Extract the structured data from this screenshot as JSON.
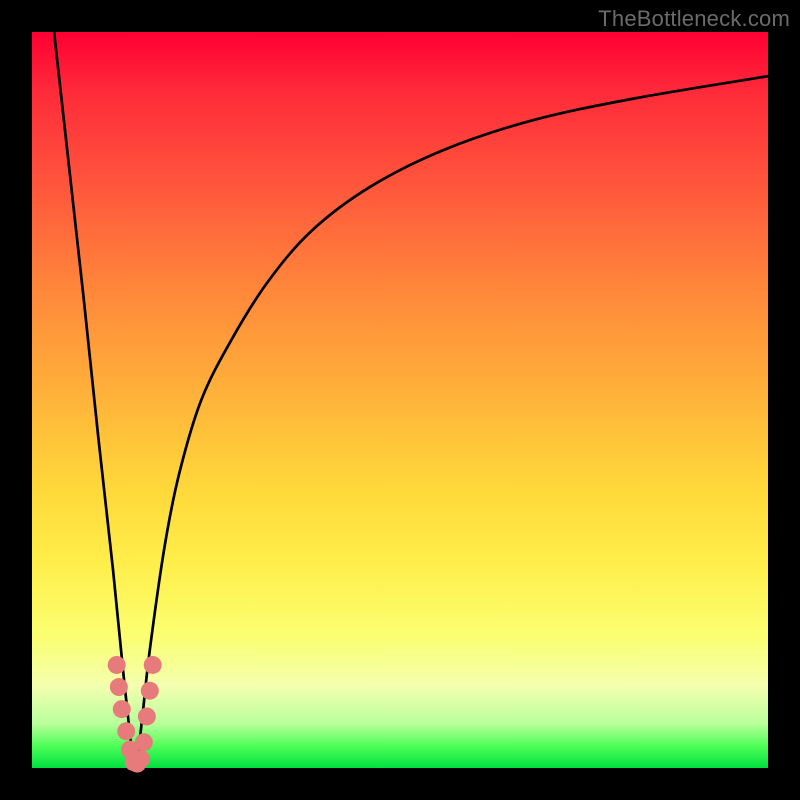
{
  "watermark": "TheBottleneck.com",
  "chart_data": {
    "type": "line",
    "title": "",
    "xlabel": "",
    "ylabel": "",
    "xlim": [
      0,
      100
    ],
    "ylim": [
      0,
      100
    ],
    "series": [
      {
        "name": "left-falling-line",
        "x": [
          3,
          5,
          7,
          9,
          11,
          12.5,
          13.8
        ],
        "y": [
          100,
          82,
          64,
          45,
          27,
          12,
          0
        ]
      },
      {
        "name": "right-rising-curve",
        "x": [
          14.2,
          15,
          16,
          18,
          20,
          23,
          27,
          32,
          38,
          46,
          56,
          68,
          82,
          100
        ],
        "y": [
          0,
          7,
          16,
          30,
          40,
          50,
          58,
          66,
          73,
          79,
          84,
          88,
          91,
          94
        ]
      }
    ],
    "scatter": {
      "name": "bottleneck-cluster",
      "color": "#e77b7b",
      "points": [
        {
          "x": 11.5,
          "y": 14
        },
        {
          "x": 11.8,
          "y": 11
        },
        {
          "x": 12.2,
          "y": 8
        },
        {
          "x": 12.8,
          "y": 5
        },
        {
          "x": 13.3,
          "y": 2.5
        },
        {
          "x": 13.8,
          "y": 0.8
        },
        {
          "x": 14.3,
          "y": 0.6
        },
        {
          "x": 14.8,
          "y": 1.2
        },
        {
          "x": 15.2,
          "y": 3.5
        },
        {
          "x": 15.6,
          "y": 7
        },
        {
          "x": 16.0,
          "y": 10.5
        },
        {
          "x": 16.4,
          "y": 14
        }
      ]
    },
    "gradient_stops_top_to_bottom": [
      {
        "pos": 0,
        "color": "#ff0033"
      },
      {
        "pos": 50,
        "color": "#ffb43a"
      },
      {
        "pos": 82,
        "color": "#fbff70"
      },
      {
        "pos": 100,
        "color": "#00e040"
      }
    ]
  }
}
